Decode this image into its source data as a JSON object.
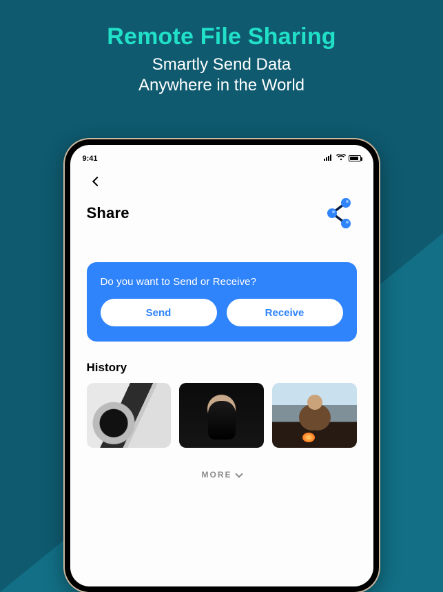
{
  "promo": {
    "title": "Remote File Sharing",
    "subtitle_line1": "Smartly Send Data",
    "subtitle_line2": "Anywhere in the World"
  },
  "status": {
    "time": "9:41"
  },
  "header": {
    "title": "Share"
  },
  "card": {
    "prompt": "Do you want to Send or Receive?",
    "send_label": "Send",
    "receive_label": "Receive"
  },
  "history": {
    "title": "History",
    "more_label": "MORE"
  }
}
